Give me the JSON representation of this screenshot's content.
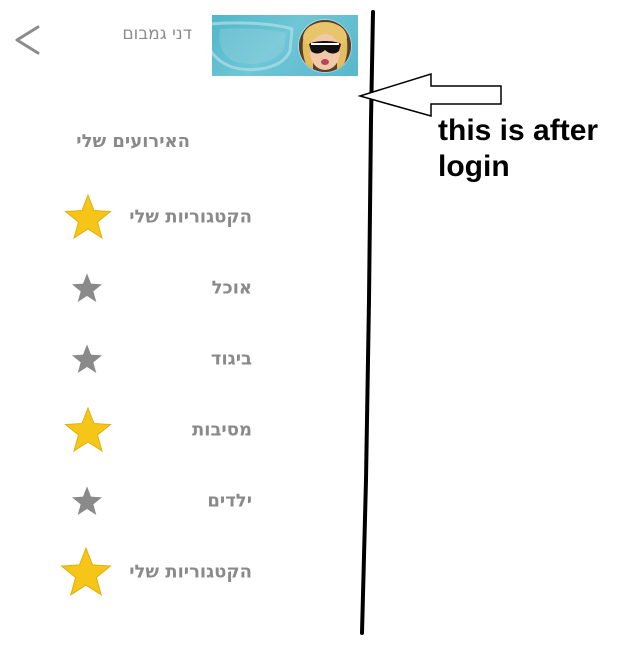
{
  "header": {
    "user_name": "דני גמבום"
  },
  "menu": {
    "title": "האירועים שלי",
    "items": [
      {
        "label": "הקטגוריות שלי",
        "icon": "star-icon",
        "highlighted": true
      },
      {
        "label": "אוכל",
        "icon": "star-icon",
        "highlighted": false
      },
      {
        "label": "ביגוד",
        "icon": "star-icon",
        "highlighted": false
      },
      {
        "label": "מסיבות",
        "icon": "star-icon",
        "highlighted": true
      },
      {
        "label": "ילדים",
        "icon": "star-icon",
        "highlighted": false
      },
      {
        "label": "הקטגוריות שלי",
        "icon": "star-icon",
        "highlighted": true
      }
    ]
  },
  "annotation": {
    "text": "this is after login"
  },
  "colors": {
    "star_highlighted": "#f5c518",
    "star_default": "#8a8a8a",
    "text_gray": "#8a8a8a",
    "banner": "#58b7cb"
  }
}
